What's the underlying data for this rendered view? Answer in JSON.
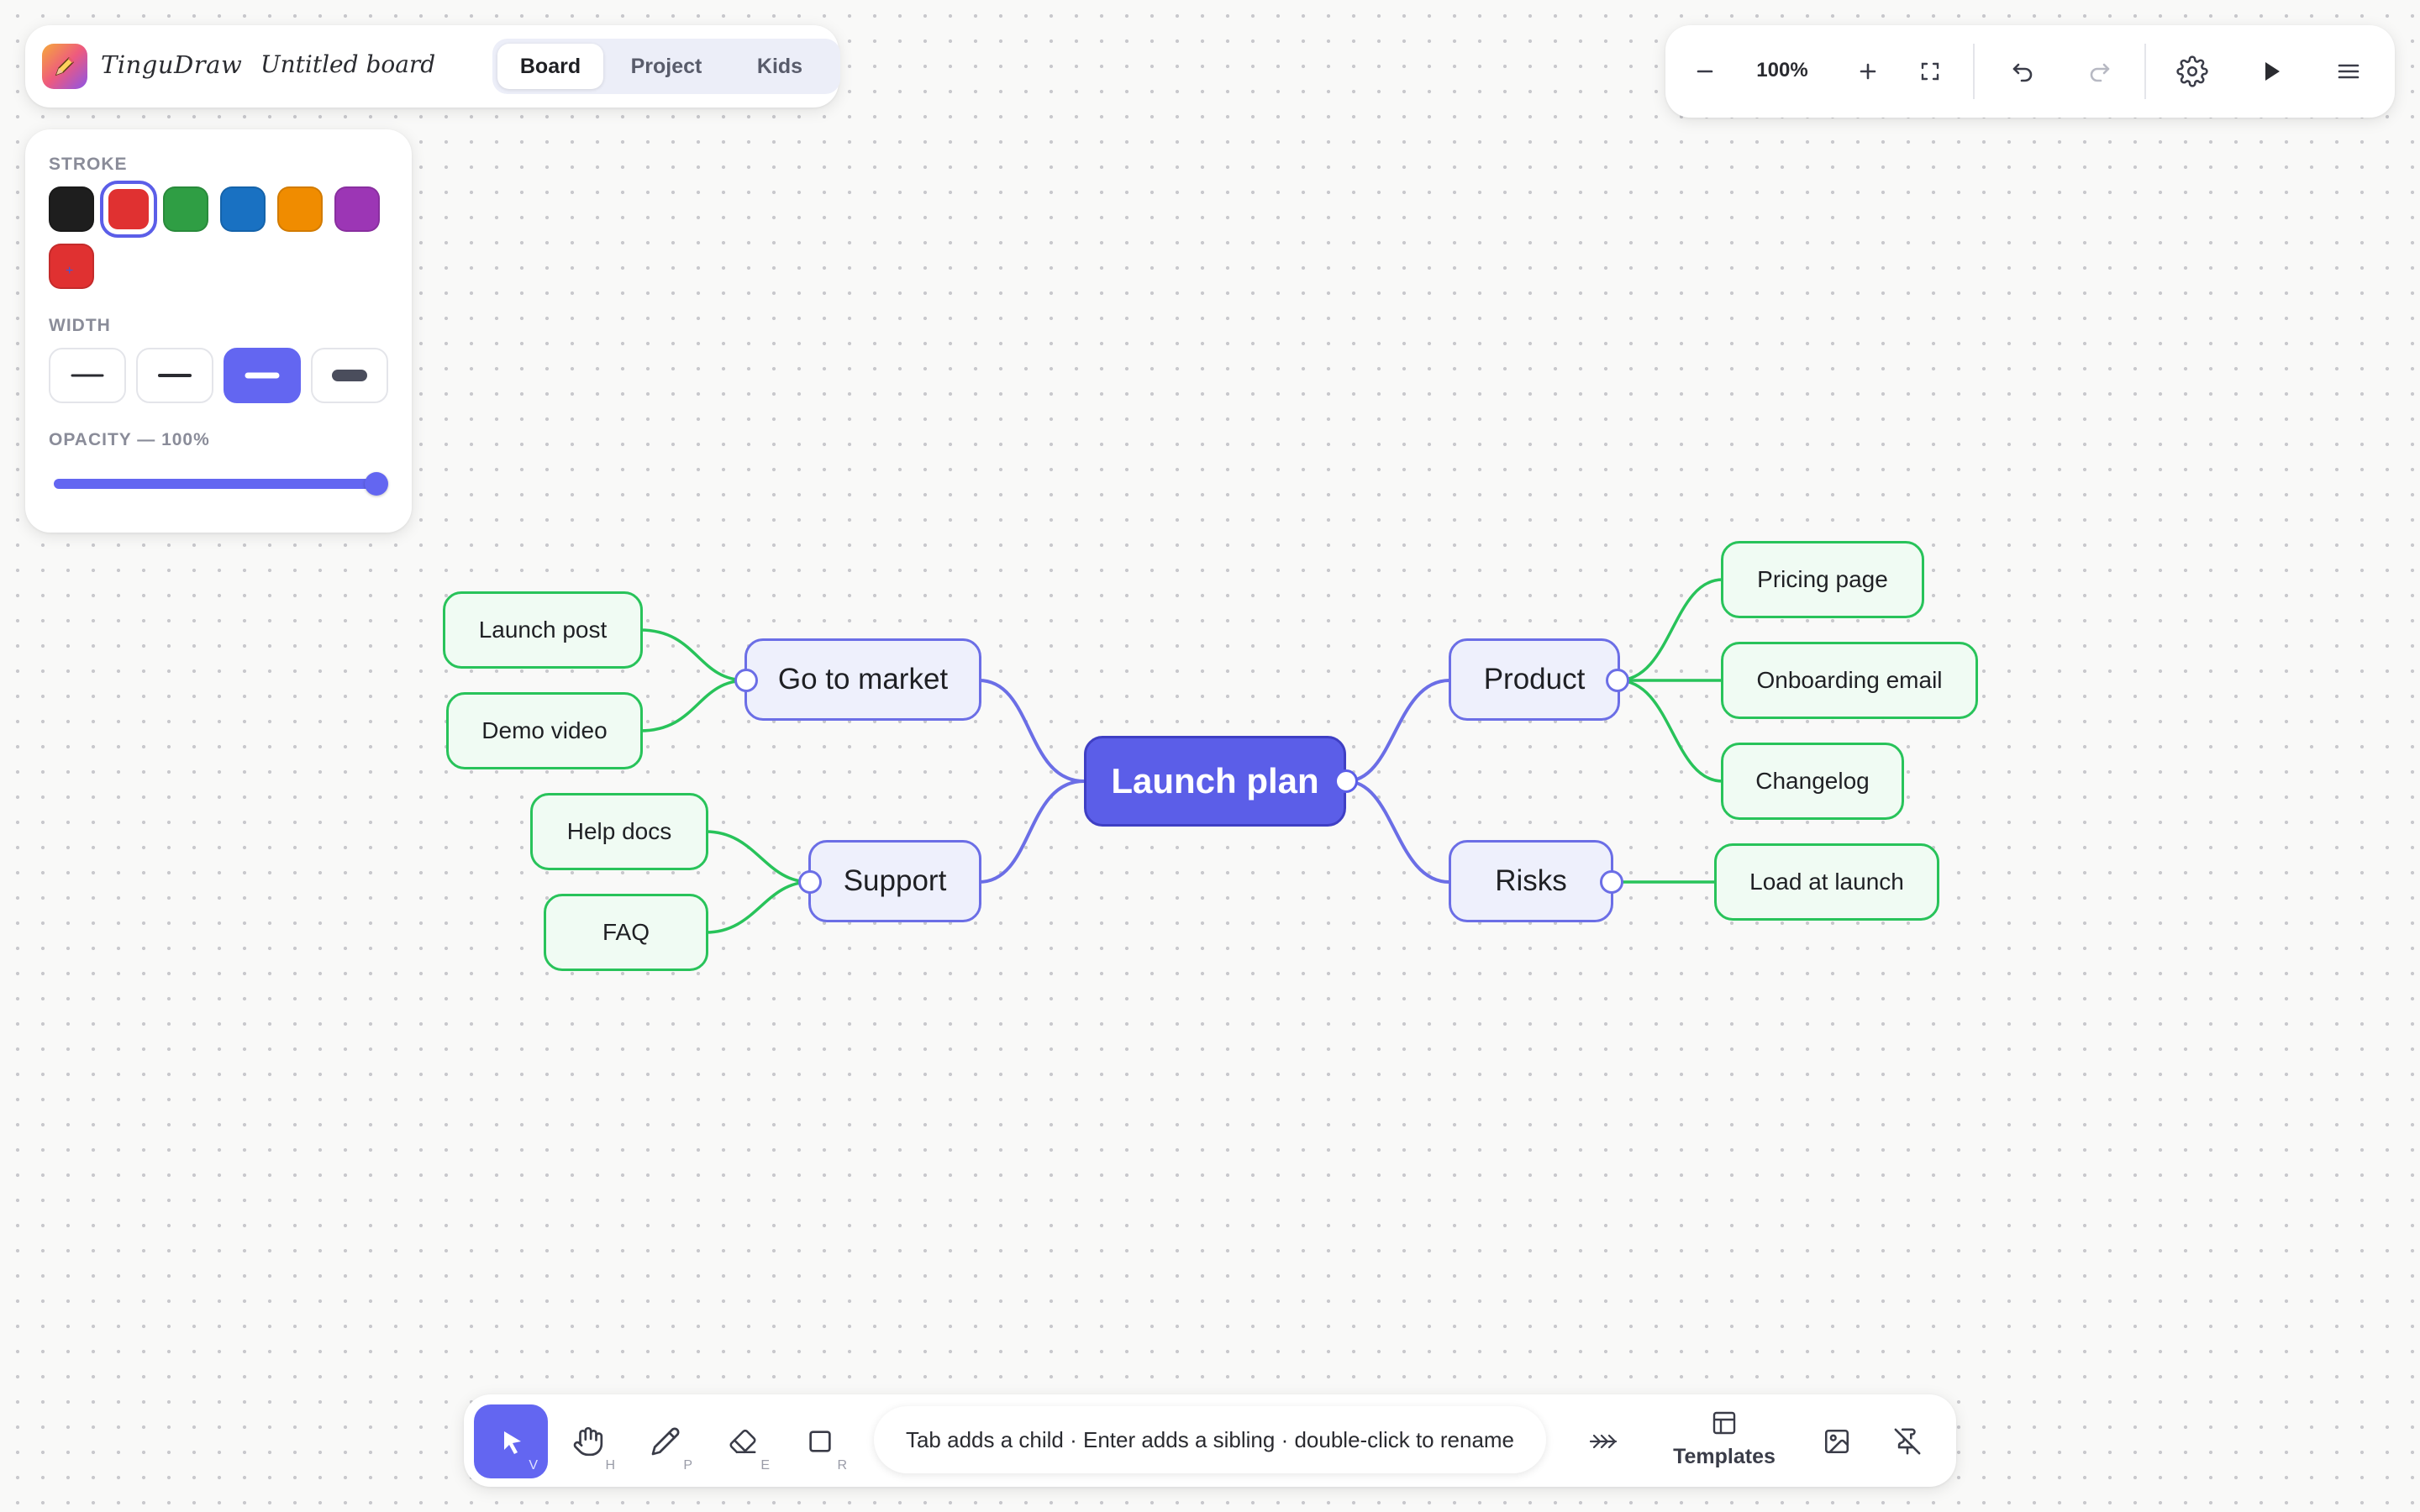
{
  "app": {
    "name": "TinguDraw",
    "board_title": "Untitled board"
  },
  "mode_tabs": [
    {
      "label": "Board",
      "active": true
    },
    {
      "label": "Project",
      "active": false
    },
    {
      "label": "Kids",
      "active": false
    }
  ],
  "topbar": {
    "zoom_level": "100%",
    "icons": [
      "zoom-out-icon",
      "zoom-in-icon",
      "fit-screen-icon",
      "undo-icon",
      "redo-icon",
      "settings-icon",
      "play-icon",
      "menu-icon"
    ]
  },
  "stroke_panel": {
    "stroke_label": "STROKE",
    "swatches": [
      "#1e1e1e",
      "#e03131",
      "#2f9e44",
      "#1971c2",
      "#f08c00",
      "#9c36b5"
    ],
    "selected_swatch": "#e03131",
    "custom_swatch": {
      "color": "#e03131",
      "label": "+"
    },
    "width_label": "WIDTH",
    "widths": [
      "thin",
      "regular",
      "bold",
      "extra-bold"
    ],
    "selected_width": "bold",
    "opacity_label": "OPACITY — 100%",
    "opacity": 1.0
  },
  "mindmap": {
    "root": "Launch plan",
    "branches": {
      "go_to_market": "Go to market",
      "support": "Support",
      "product": "Product",
      "risks": "Risks"
    },
    "leaves": {
      "launch_post": "Launch post",
      "demo_video": "Demo video",
      "help_docs": "Help docs",
      "faq": "FAQ",
      "pricing_page": "Pricing page",
      "onboarding_email": "Onboarding email",
      "changelog": "Changelog",
      "load_at_launch": "Load at launch"
    },
    "colors": {
      "root": "#5b5ee8",
      "branch_edge": "#6b6ee6",
      "leaf_edge": "#28c35a"
    }
  },
  "bottombar": {
    "tools": [
      {
        "name": "select",
        "shortcut": "V",
        "active": true
      },
      {
        "name": "hand",
        "shortcut": "H",
        "active": false
      },
      {
        "name": "pen",
        "shortcut": "P",
        "active": false
      },
      {
        "name": "eraser",
        "shortcut": "E",
        "active": false
      },
      {
        "name": "rectangle",
        "shortcut": "R",
        "active": false
      }
    ],
    "hint": "Tab adds a child · Enter adds a sibling · double-click to rename",
    "templates_label": "Templates"
  }
}
